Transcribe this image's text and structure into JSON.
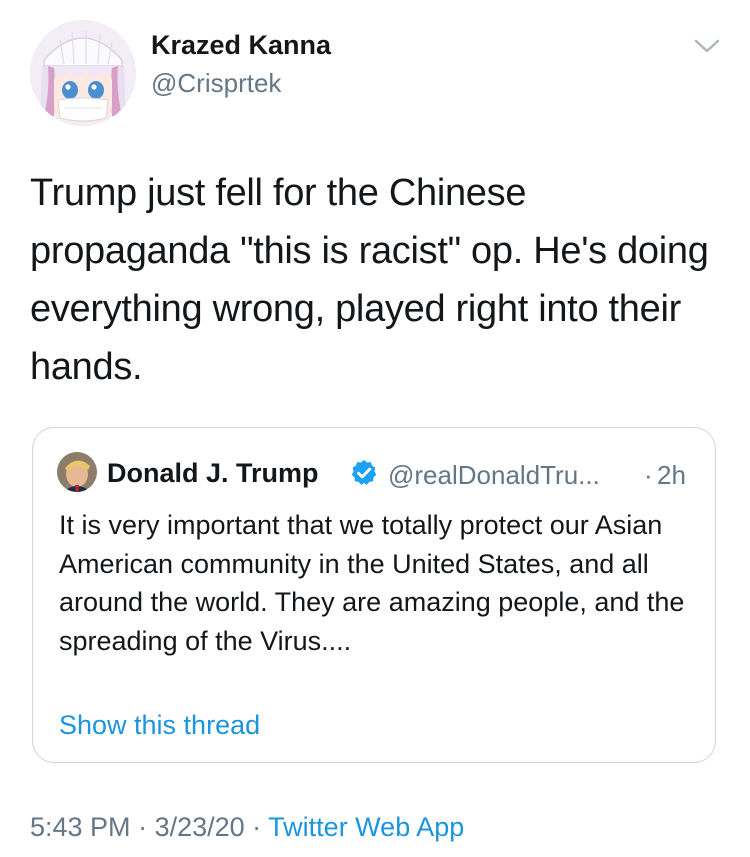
{
  "author": {
    "display_name": "Krazed Kanna",
    "handle": "@Crisprtek",
    "avatar_icon": "anime-character-avatar"
  },
  "tweet": {
    "text": "Trump just fell for the Chinese propaganda \"this is racist\" op. He's doing everything wrong, played right into their hands."
  },
  "menu": {
    "icon": "chevron-down-icon"
  },
  "quoted_tweet": {
    "display_name": "Donald J. Trump",
    "verified": true,
    "handle": "@realDonaldTru...",
    "separator": "·",
    "time": "2h",
    "text": "It is very important that we totally protect our Asian American community in the United States, and all around the world. They are amazing people, and the spreading of the Virus....",
    "show_thread": "Show this thread"
  },
  "meta": {
    "time": "5:43 PM",
    "sep1": " · ",
    "date": "3/23/20",
    "sep2": " · ",
    "source": "Twitter Web App"
  },
  "colors": {
    "link": "#1b95e0",
    "secondary_text": "#657786",
    "border": "#ccd6dd"
  }
}
